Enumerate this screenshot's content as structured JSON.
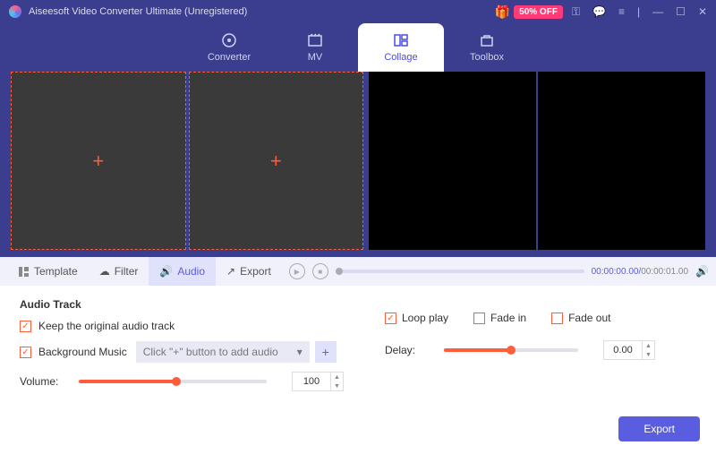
{
  "app": {
    "title": "Aiseesoft Video Converter Ultimate (Unregistered)",
    "promo": "50% OFF"
  },
  "nav": {
    "converter": "Converter",
    "mv": "MV",
    "collage": "Collage",
    "toolbox": "Toolbox"
  },
  "subtabs": {
    "template": "Template",
    "filter": "Filter",
    "audio": "Audio",
    "export": "Export"
  },
  "player": {
    "current": "00:00:00.00",
    "total": "00:00:01.00"
  },
  "audio": {
    "section": "Audio Track",
    "keep": "Keep the original audio track",
    "bgm": "Background Music",
    "bgm_placeholder": "Click \"+\" button to add audio",
    "volume_label": "Volume:",
    "volume_value": "100",
    "loop": "Loop play",
    "fadein": "Fade in",
    "fadeout": "Fade out",
    "delay_label": "Delay:",
    "delay_value": "0.00"
  },
  "footer": {
    "export": "Export"
  }
}
